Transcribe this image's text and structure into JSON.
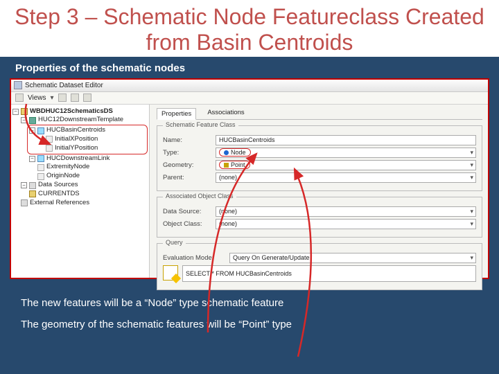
{
  "slide": {
    "title": "Step 3 – Schematic Node Featureclass Created from Basin Centroids",
    "subtitle": "Properties of the schematic nodes",
    "caption1": "The new features will be a “Node” type schematic feature",
    "caption2": "The geometry of the schematic features will be “Point” type"
  },
  "editor": {
    "title": "Schematic Dataset Editor",
    "toolbar": {
      "views_label": "Views"
    }
  },
  "tree": {
    "root": "WBDHUC12SchematicsDS",
    "template": "HUC12DownstreamTemplate",
    "fc_selected": "HUCBasinCentroids",
    "field_x": "InitialXPosition",
    "field_y": "InitialYPosition",
    "fc_link": "HUCDownstreamLink",
    "fld_extremity": "ExtremityNode",
    "fld_origin": "OriginNode",
    "data_sources": "Data Sources",
    "currentds": "CURRENTDS",
    "ext_refs": "External References"
  },
  "props": {
    "tab_properties": "Properties",
    "tab_associations": "Associations",
    "group_sfc": "Schematic Feature Class",
    "label_name": "Name:",
    "value_name": "HUCBasinCentroids",
    "label_type": "Type:",
    "value_type": "Node",
    "label_geometry": "Geometry:",
    "value_geometry": "Point",
    "label_parent": "Parent:",
    "value_parent": "(none)",
    "group_aoc": "Associated Object Class",
    "label_datasource": "Data Source:",
    "value_datasource": "(none)",
    "label_objectclass": "Object Class:",
    "value_objectclass": "(none)",
    "group_query": "Query",
    "label_evalmode": "Evaluation Mode:",
    "value_evalmode": "Query On Generate/Update",
    "value_sql": "SELECT * FROM HUCBasinCentroids"
  }
}
